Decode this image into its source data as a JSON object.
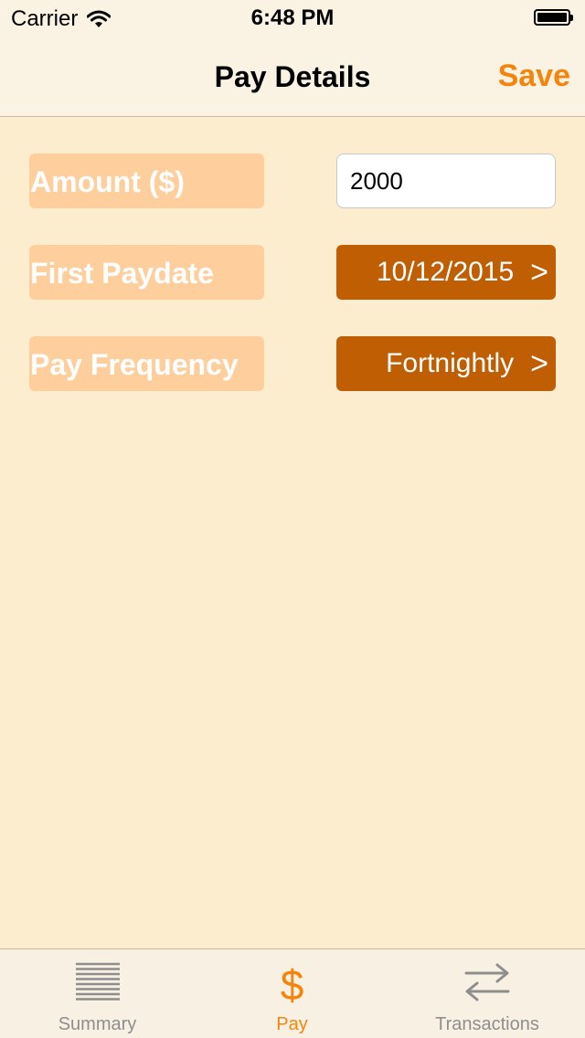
{
  "status_bar": {
    "carrier": "Carrier",
    "time": "6:48 PM"
  },
  "nav": {
    "title": "Pay Details",
    "save_label": "Save"
  },
  "form": {
    "amount": {
      "label": "Amount ($)",
      "value": "2000"
    },
    "first_paydate": {
      "label": "First Paydate",
      "value": "10/12/2015",
      "chevron": ">"
    },
    "pay_frequency": {
      "label": "Pay Frequency",
      "value": "Fortnightly",
      "chevron": ">"
    }
  },
  "tabs": {
    "summary": {
      "label": "Summary",
      "icon": "list-icon"
    },
    "pay": {
      "label": "Pay",
      "icon": "dollar-icon",
      "glyph": "$",
      "active": true
    },
    "transactions": {
      "label": "Transactions",
      "icon": "transfer-arrows-icon"
    }
  },
  "colors": {
    "accent": "#f5840c",
    "picker_bg": "#bf5e03",
    "label_bg": "#fecf9d",
    "page_bg": "#fdedcf"
  }
}
